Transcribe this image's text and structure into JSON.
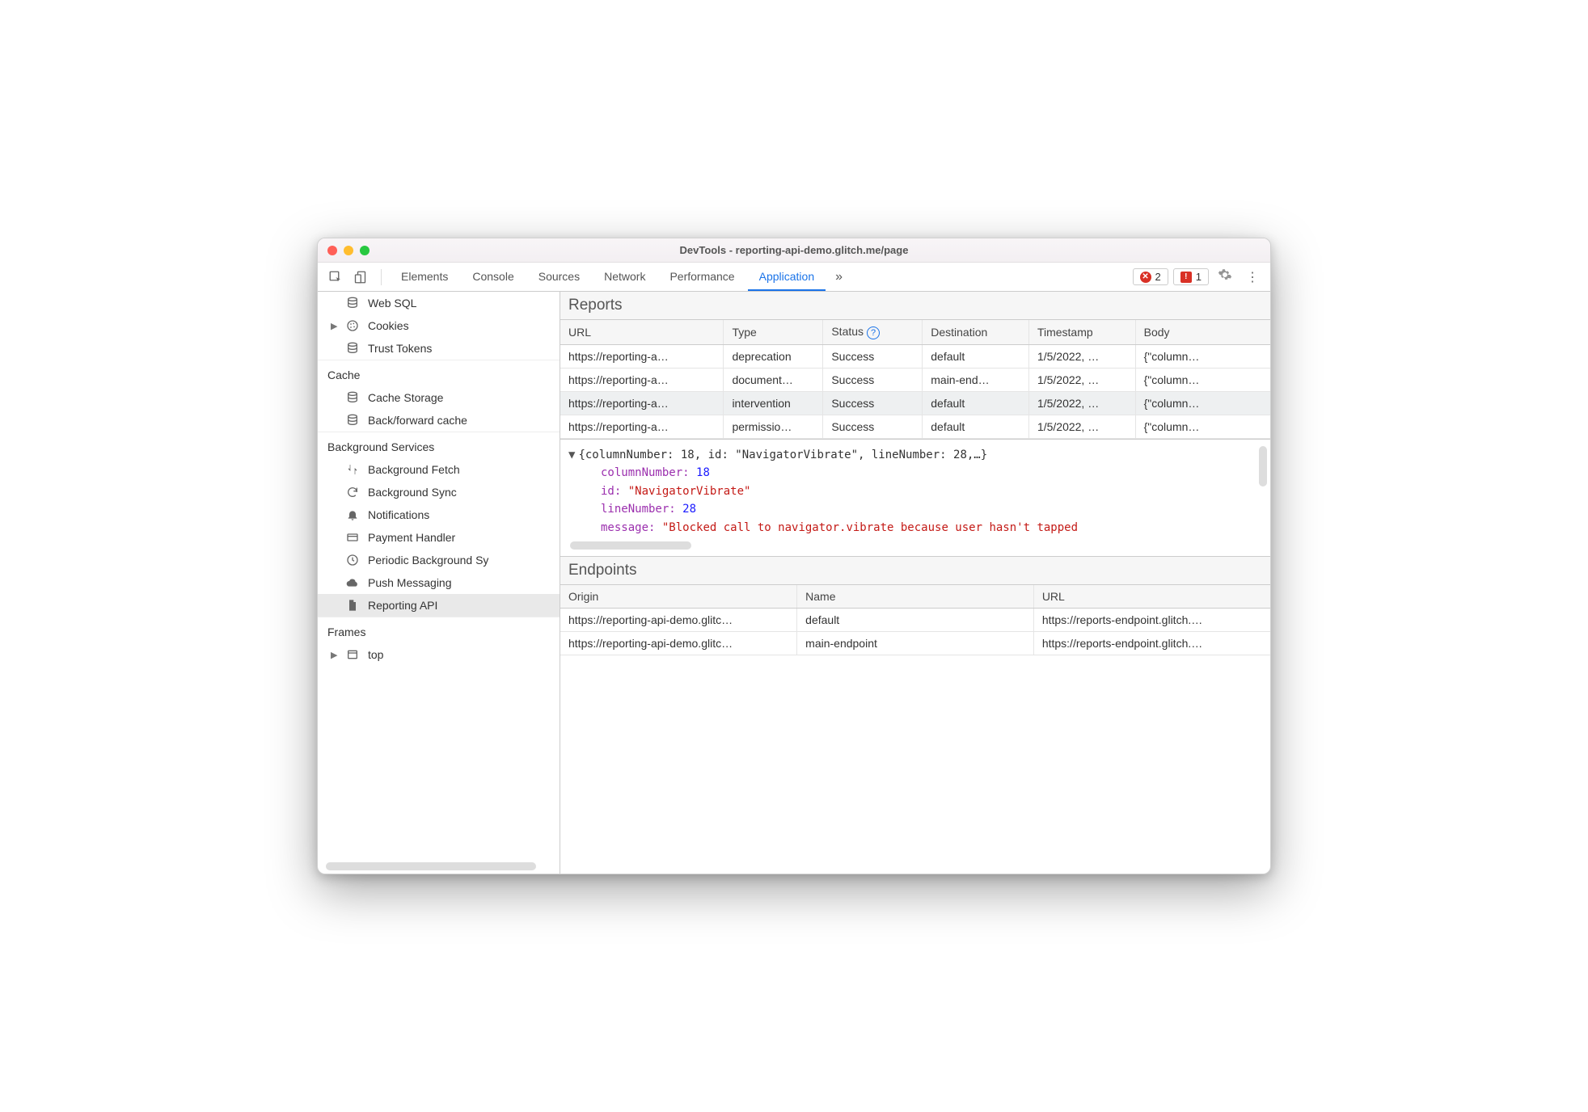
{
  "window": {
    "title": "DevTools - reporting-api-demo.glitch.me/page"
  },
  "tabs": {
    "items": [
      "Elements",
      "Console",
      "Sources",
      "Network",
      "Performance",
      "Application"
    ],
    "active": "Application",
    "more": "»",
    "errors": "2",
    "issues": "1"
  },
  "sidebar": {
    "storage": {
      "web_sql": "Web SQL",
      "cookies": "Cookies",
      "trust_tokens": "Trust Tokens"
    },
    "cache": {
      "title": "Cache",
      "cache_storage": "Cache Storage",
      "back_forward": "Back/forward cache"
    },
    "bg": {
      "title": "Background Services",
      "fetch": "Background Fetch",
      "sync": "Background Sync",
      "notifications": "Notifications",
      "payment": "Payment Handler",
      "periodic": "Periodic Background Sy",
      "push": "Push Messaging",
      "reporting": "Reporting API"
    },
    "frames": {
      "title": "Frames",
      "top": "top"
    }
  },
  "reports": {
    "title": "Reports",
    "headers": {
      "url": "URL",
      "type": "Type",
      "status": "Status",
      "dest": "Destination",
      "ts": "Timestamp",
      "body": "Body"
    },
    "rows": [
      {
        "url": "https://reporting-a…",
        "type": "deprecation",
        "status": "Success",
        "dest": "default",
        "ts": "1/5/2022, …",
        "body": "{\"column…"
      },
      {
        "url": "https://reporting-a…",
        "type": "document…",
        "status": "Success",
        "dest": "main-end…",
        "ts": "1/5/2022, …",
        "body": "{\"column…"
      },
      {
        "url": "https://reporting-a…",
        "type": "intervention",
        "status": "Success",
        "dest": "default",
        "ts": "1/5/2022, …",
        "body": "{\"column…"
      },
      {
        "url": "https://reporting-a…",
        "type": "permissio…",
        "status": "Success",
        "dest": "default",
        "ts": "1/5/2022, …",
        "body": "{\"column…"
      }
    ],
    "selected_index": 2
  },
  "detail": {
    "summary": "{columnNumber: 18, id: \"NavigatorVibrate\", lineNumber: 28,…}",
    "columnNumber_key": "columnNumber:",
    "columnNumber_val": "18",
    "id_key": "id:",
    "id_val": "\"NavigatorVibrate\"",
    "lineNumber_key": "lineNumber:",
    "lineNumber_val": "28",
    "message_key": "message:",
    "message_val": "\"Blocked call to navigator.vibrate because user hasn't tapped"
  },
  "endpoints": {
    "title": "Endpoints",
    "headers": {
      "origin": "Origin",
      "name": "Name",
      "url": "URL"
    },
    "rows": [
      {
        "origin": "https://reporting-api-demo.glitc…",
        "name": "default",
        "url": "https://reports-endpoint.glitch.…"
      },
      {
        "origin": "https://reporting-api-demo.glitc…",
        "name": "main-endpoint",
        "url": "https://reports-endpoint.glitch.…"
      }
    ]
  }
}
